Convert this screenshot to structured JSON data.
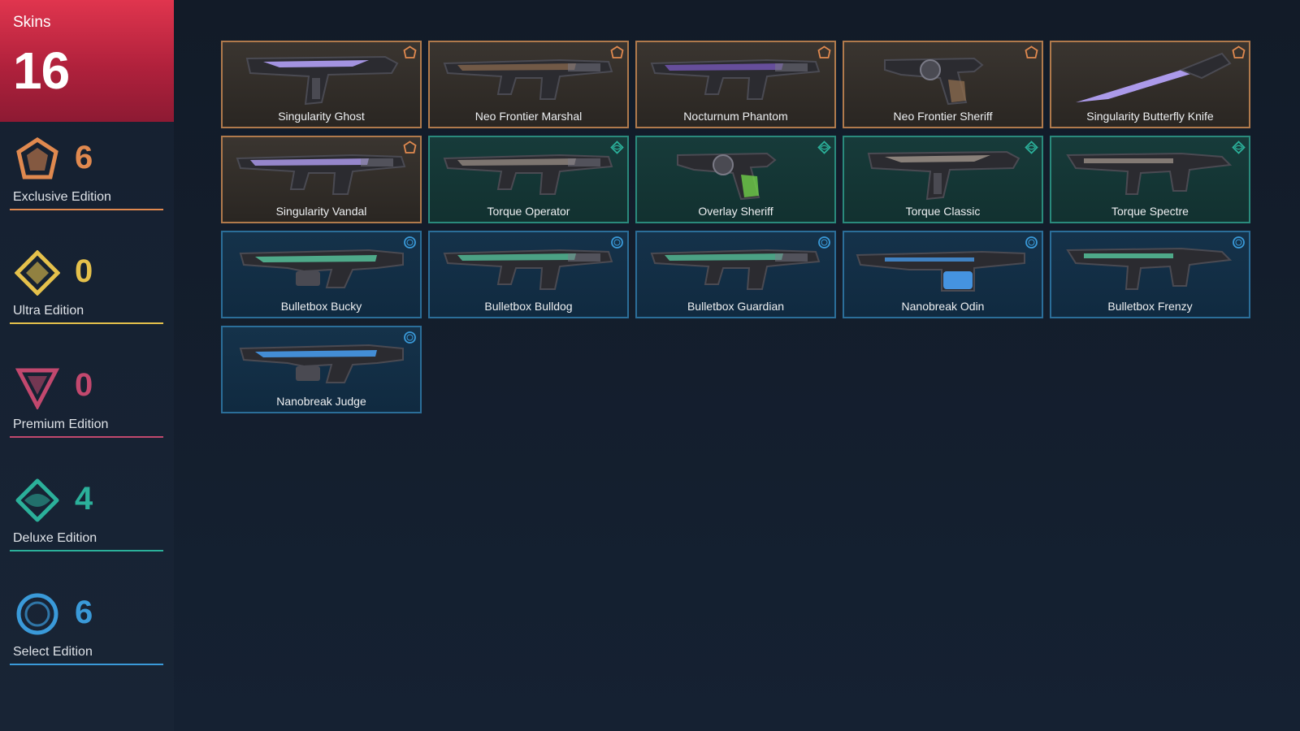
{
  "summary": {
    "label": "Skins",
    "total": "16"
  },
  "colors": {
    "exclusive": "#e0894f",
    "ultra": "#e5c14b",
    "premium": "#c2486e",
    "deluxe": "#2bb09a",
    "select": "#3a9ad9"
  },
  "tiers": [
    {
      "id": "exclusive",
      "icon": "exclusive-edition-icon",
      "count": "6",
      "label": "Exclusive Edition"
    },
    {
      "id": "ultra",
      "icon": "ultra-edition-icon",
      "count": "0",
      "label": "Ultra Edition"
    },
    {
      "id": "premium",
      "icon": "premium-edition-icon",
      "count": "0",
      "label": "Premium Edition"
    },
    {
      "id": "deluxe",
      "icon": "deluxe-edition-icon",
      "count": "4",
      "label": "Deluxe Edition"
    },
    {
      "id": "select",
      "icon": "select-edition-icon",
      "count": "6",
      "label": "Select Edition"
    }
  ],
  "skins": [
    {
      "name": "Singularity Ghost",
      "tier": "exclusive",
      "weapon": "pistol"
    },
    {
      "name": "Neo Frontier Marshal",
      "tier": "exclusive",
      "weapon": "rifle"
    },
    {
      "name": "Nocturnum Phantom",
      "tier": "exclusive",
      "weapon": "rifle"
    },
    {
      "name": "Neo Frontier Sheriff",
      "tier": "exclusive",
      "weapon": "revolver"
    },
    {
      "name": "Singularity Butterfly Knife",
      "tier": "exclusive",
      "weapon": "knife"
    },
    {
      "name": "Singularity Vandal",
      "tier": "exclusive",
      "weapon": "rifle"
    },
    {
      "name": "Torque Operator",
      "tier": "deluxe",
      "weapon": "rifle"
    },
    {
      "name": "Overlay Sheriff",
      "tier": "deluxe",
      "weapon": "revolver"
    },
    {
      "name": "Torque Classic",
      "tier": "deluxe",
      "weapon": "pistol"
    },
    {
      "name": "Torque Spectre",
      "tier": "deluxe",
      "weapon": "smg"
    },
    {
      "name": "Bulletbox Bucky",
      "tier": "select",
      "weapon": "shotgun"
    },
    {
      "name": "Bulletbox Bulldog",
      "tier": "select",
      "weapon": "rifle"
    },
    {
      "name": "Bulletbox Guardian",
      "tier": "select",
      "weapon": "rifle"
    },
    {
      "name": "Nanobreak Odin",
      "tier": "select",
      "weapon": "lmg"
    },
    {
      "name": "Bulletbox Frenzy",
      "tier": "select",
      "weapon": "smg"
    },
    {
      "name": "Nanobreak Judge",
      "tier": "select",
      "weapon": "shotgun"
    }
  ]
}
